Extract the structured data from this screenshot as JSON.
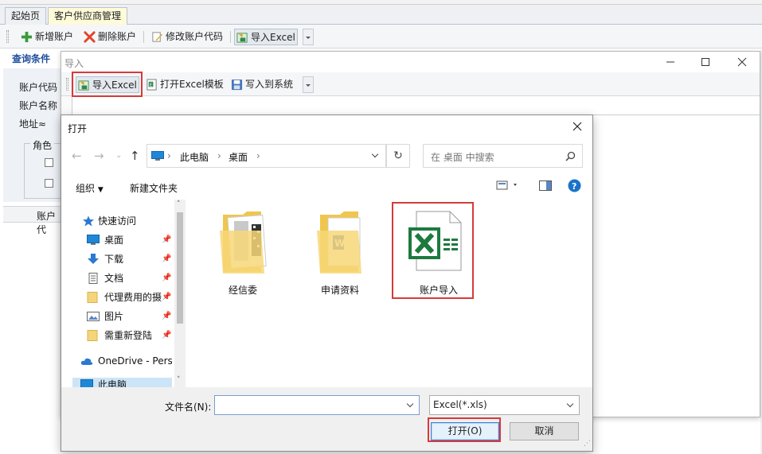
{
  "app": {
    "tabs": [
      {
        "label": "起始页"
      },
      {
        "label": "客户供应商管理"
      }
    ],
    "toolbar": {
      "new_account": "新增账户",
      "delete_account": "删除账户",
      "modify_code": "修改账户代码",
      "import_excel": "导入Excel"
    },
    "query": {
      "header": "查询条件",
      "account_code": "账户代码",
      "account_name": "账户名称",
      "address": "地址≈",
      "role": "角色"
    },
    "grid": {
      "col_account": "账户代"
    }
  },
  "import_window": {
    "title": "导入",
    "toolbar": {
      "import_excel": "导入Excel",
      "open_template": "打开Excel模板",
      "write_system": "写入到系统"
    }
  },
  "open_dialog": {
    "title": "打开",
    "address": {
      "segments": [
        "此电脑",
        "桌面"
      ]
    },
    "search_placeholder": "在 桌面 中搜索",
    "organize": "组织",
    "new_folder": "新建文件夹",
    "nav": [
      {
        "label": "快速访问",
        "icon": "star-icon"
      },
      {
        "label": "桌面",
        "icon": "desktop-icon"
      },
      {
        "label": "下载",
        "icon": "download-icon"
      },
      {
        "label": "文档",
        "icon": "document-icon"
      },
      {
        "label": "代理费用的摄",
        "icon": "folder-icon"
      },
      {
        "label": "图片",
        "icon": "picture-icon"
      },
      {
        "label": "需重新登陆",
        "icon": "folder-icon"
      },
      {
        "label": "OneDrive - Pers",
        "icon": "cloud-icon"
      },
      {
        "label": "此电脑",
        "icon": "pc-icon"
      }
    ],
    "files": [
      {
        "name": "经信委"
      },
      {
        "name": "申请资料"
      },
      {
        "name": "账户导入"
      }
    ],
    "filename_label": "文件名(N):",
    "filename_value": "",
    "filetype": "Excel(*.xls)",
    "open_button": "打开(O)",
    "cancel_button": "取消"
  },
  "colors": {
    "highlight": "#d73a3a",
    "excel_green": "#1d7a3e",
    "folder_yellow": "#f4d57a",
    "query_header": "#1f4e9e"
  }
}
